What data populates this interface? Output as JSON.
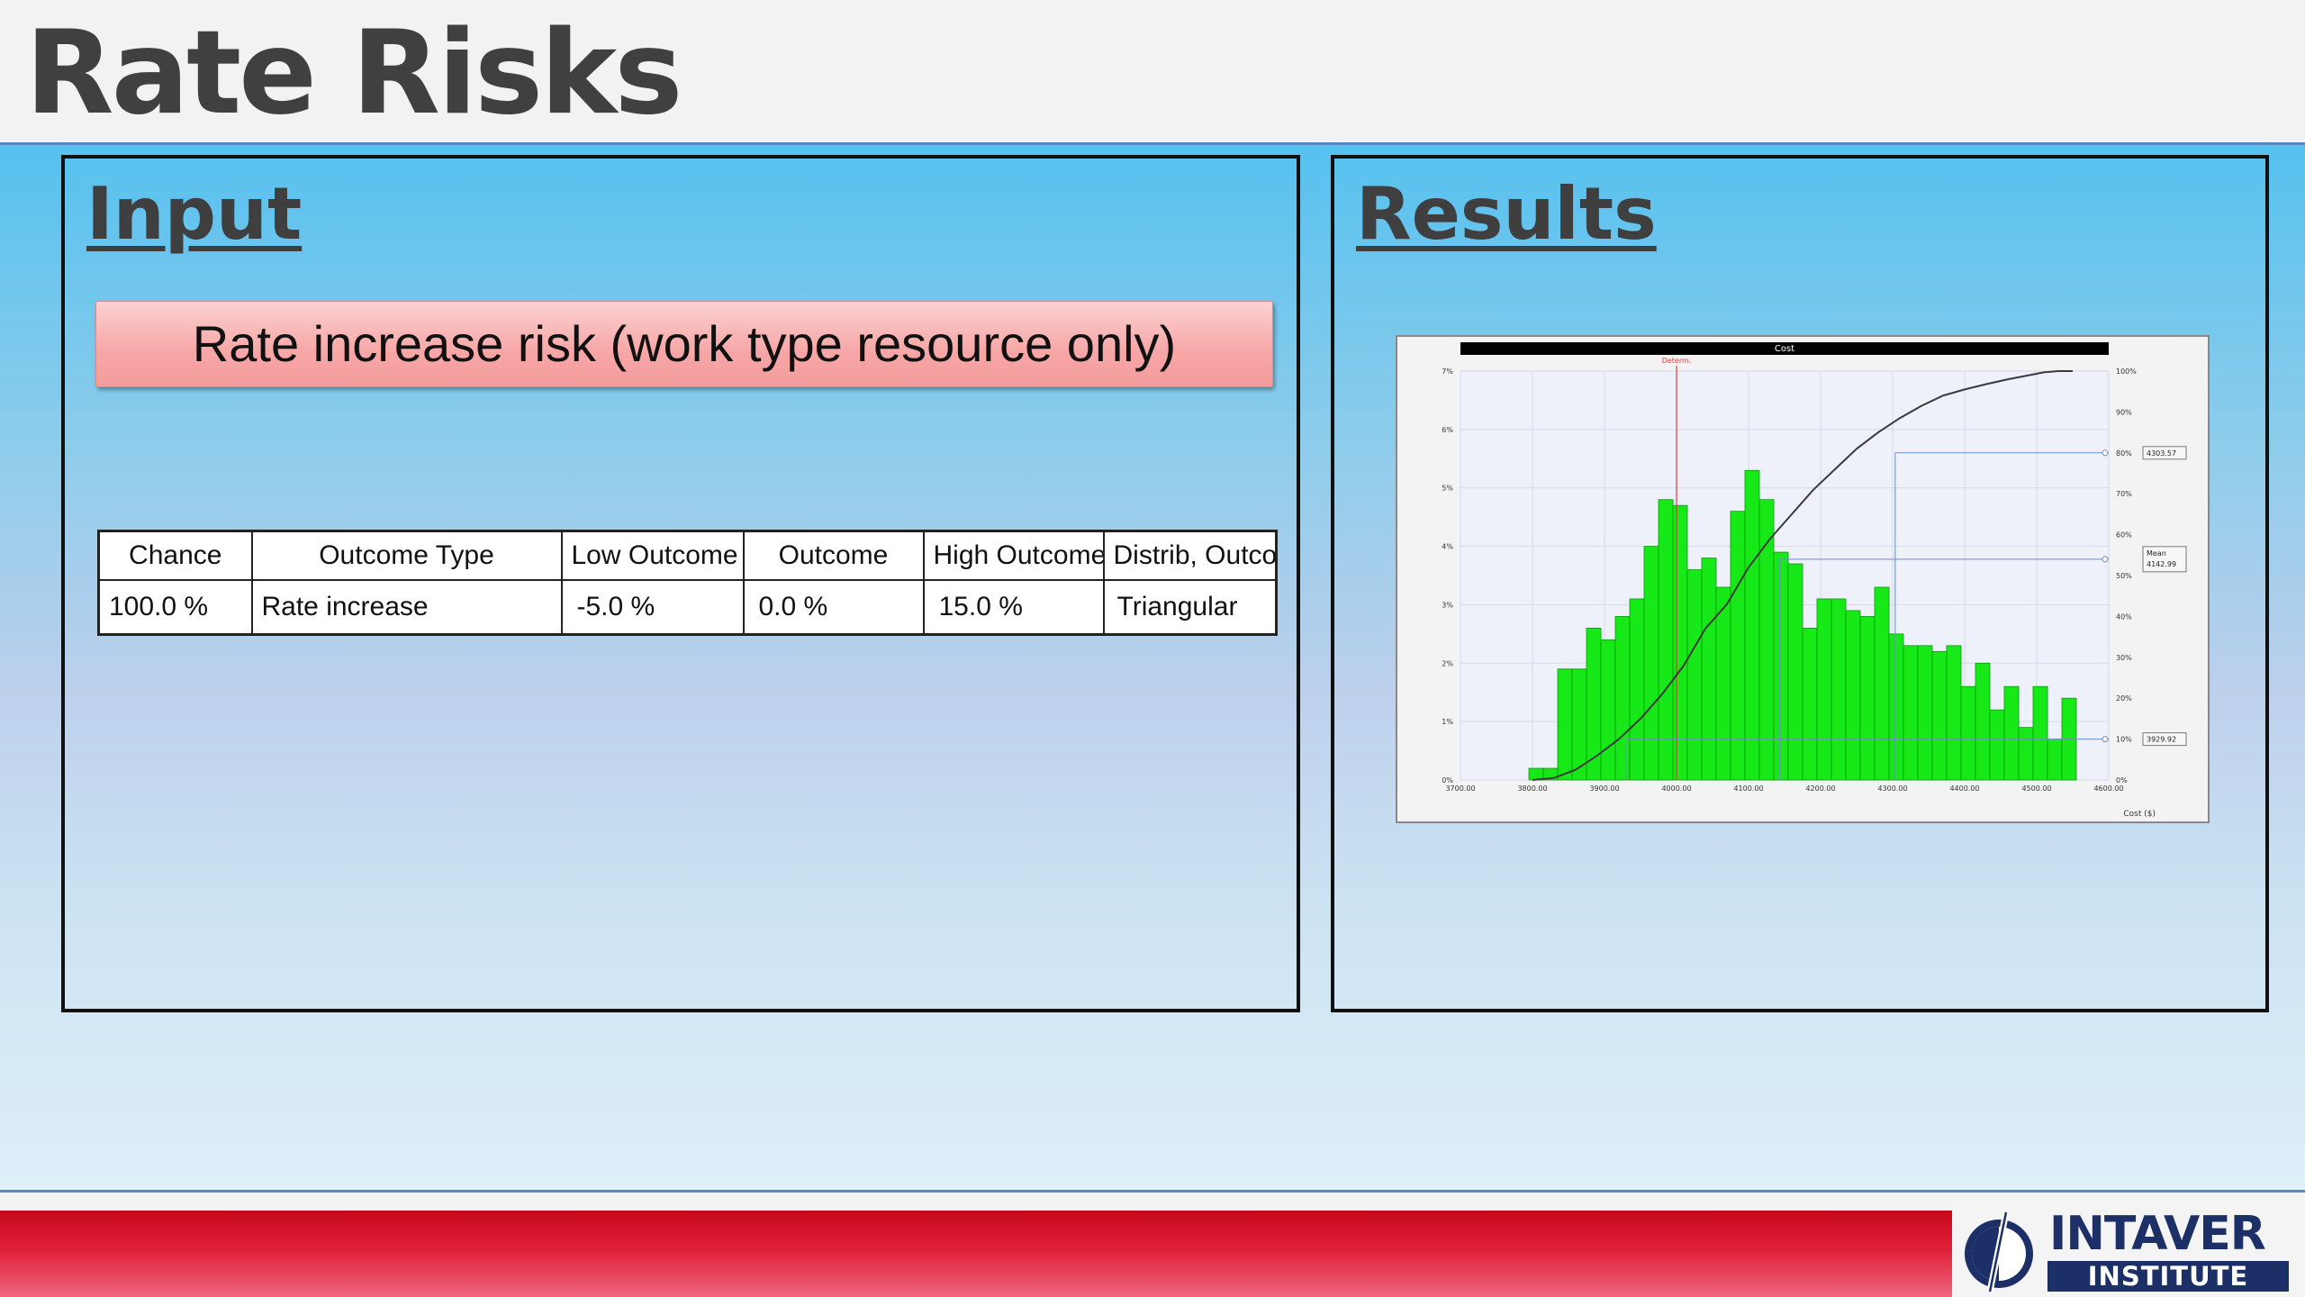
{
  "slide": {
    "title": "Rate Risks"
  },
  "input_panel": {
    "heading": "Input",
    "risk_name": "Rate increase risk (work type resource only)",
    "table": {
      "columns": [
        "Chance",
        "Outcome Type",
        "Low Outcome",
        "Outcome",
        "High Outcome",
        "Distrib, Outco"
      ],
      "rows": [
        [
          "100.0 %",
          "Rate increase",
          "-5.0 %",
          "0.0 %",
          "15.0 %",
          "Triangular"
        ]
      ]
    }
  },
  "results_panel": {
    "heading": "Results"
  },
  "chart_data": {
    "type": "bar",
    "title": "Cost",
    "xlabel": "Cost ($)",
    "ylabel": "",
    "xlim": [
      3700,
      4600
    ],
    "ylim": [
      0,
      7
    ],
    "y2lim": [
      0,
      100
    ],
    "x_ticks": [
      "3700.00",
      "3800.00",
      "3900.00",
      "4000.00",
      "4100.00",
      "4200.00",
      "4300.00",
      "4400.00",
      "4500.00",
      "4600.00"
    ],
    "y_ticks": [
      "0%",
      "1%",
      "2%",
      "3%",
      "4%",
      "5%",
      "6%",
      "7%"
    ],
    "y2_ticks": [
      "0%",
      "10%",
      "20%",
      "30%",
      "40%",
      "50%",
      "60%",
      "70%",
      "80%",
      "90%",
      "100%"
    ],
    "bin_centers": [
      3805,
      3825,
      3845,
      3865,
      3885,
      3905,
      3925,
      3945,
      3965,
      3985,
      4005,
      4025,
      4045,
      4065,
      4085,
      4105,
      4125,
      4145,
      4165,
      4185,
      4205,
      4225,
      4245,
      4265,
      4285,
      4305,
      4325,
      4345,
      4365,
      4385,
      4405,
      4425,
      4445,
      4465,
      4485,
      4505,
      4525,
      4545
    ],
    "values": [
      0.2,
      0.2,
      1.9,
      1.9,
      2.6,
      2.4,
      2.8,
      3.1,
      4.0,
      4.8,
      4.7,
      3.6,
      3.8,
      3.3,
      4.6,
      5.3,
      4.8,
      3.9,
      3.7,
      2.6,
      3.1,
      3.1,
      2.9,
      2.8,
      3.3,
      2.5,
      2.3,
      2.3,
      2.2,
      2.3,
      1.6,
      2.0,
      1.2,
      1.6,
      0.9,
      1.6,
      0.7,
      1.4
    ],
    "cumulative": {
      "x": [
        3800,
        3830,
        3860,
        3890,
        3920,
        3950,
        3980,
        4010,
        4040,
        4070,
        4100,
        4130,
        4160,
        4190,
        4220,
        4250,
        4280,
        4310,
        4340,
        4370,
        4400,
        4430,
        4460,
        4490,
        4510,
        4530,
        4550
      ],
      "y": [
        0,
        0.5,
        2.5,
        6,
        10,
        15,
        21,
        28,
        37,
        43,
        52,
        59,
        65,
        71,
        76,
        81,
        85,
        88.5,
        91.5,
        94,
        95.5,
        96.8,
        98,
        99,
        99.7,
        100,
        100
      ]
    },
    "reference_lines": [
      {
        "label": "Determ.",
        "x": 4000,
        "color": "#e23b3b"
      },
      {
        "label": "4303.57",
        "x": 4303.57,
        "percentile": 80,
        "color": "#6d8fbf"
      },
      {
        "label": "Mean 4142.99",
        "x": 4142.99,
        "percentile": 54,
        "color": "#6d8fbf"
      },
      {
        "label": "3929.92",
        "x": 3929.92,
        "percentile": 10,
        "color": "#6d8fbf"
      }
    ],
    "grid": true,
    "colors": {
      "bars": "#17e817",
      "bar_edge": "#0a9a0a",
      "cumulative": "#3a3a3a",
      "title_bar": "#000000"
    }
  },
  "logo": {
    "word": "INTAVER",
    "sub": "INSTITUTE"
  }
}
